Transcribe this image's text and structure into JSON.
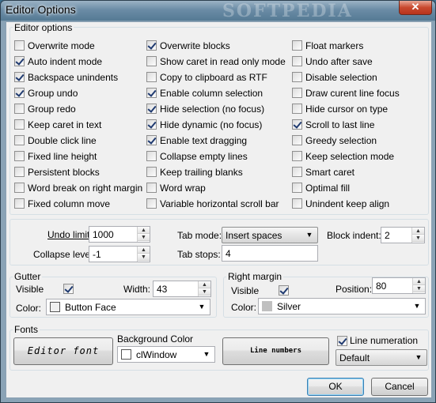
{
  "window": {
    "title": "Editor Options",
    "watermark": "SOFTPEDIA",
    "close_glyph": "✕"
  },
  "editor_options": {
    "label": "Editor options",
    "columns": [
      [
        {
          "label": "Overwrite mode",
          "checked": false
        },
        {
          "label": "Auto indent mode",
          "checked": true
        },
        {
          "label": "Backspace unindents",
          "checked": true
        },
        {
          "label": "Group undo",
          "checked": true
        },
        {
          "label": "Group redo",
          "checked": false
        },
        {
          "label": "Keep caret in text",
          "checked": false
        },
        {
          "label": "Double click line",
          "checked": false
        },
        {
          "label": "Fixed line height",
          "checked": false
        },
        {
          "label": "Persistent blocks",
          "checked": false
        },
        {
          "label": "Word break on right margin",
          "checked": false
        },
        {
          "label": "Fixed column move",
          "checked": false
        }
      ],
      [
        {
          "label": "Overwrite blocks",
          "checked": true
        },
        {
          "label": "Show caret in read only mode",
          "checked": false
        },
        {
          "label": "Copy to clipboard as RTF",
          "checked": false
        },
        {
          "label": "Enable column selection",
          "checked": true
        },
        {
          "label": "Hide selection (no focus)",
          "checked": true
        },
        {
          "label": "Hide dynamic (no focus)",
          "checked": true
        },
        {
          "label": "Enable text dragging",
          "checked": true
        },
        {
          "label": "Collapse empty lines",
          "checked": false
        },
        {
          "label": "Keep trailing blanks",
          "checked": false
        },
        {
          "label": "Word wrap",
          "checked": false
        },
        {
          "label": "Variable horizontal scroll bar",
          "checked": false
        }
      ],
      [
        {
          "label": "Float markers",
          "checked": false
        },
        {
          "label": "Undo after save",
          "checked": false
        },
        {
          "label": "Disable selection",
          "checked": false
        },
        {
          "label": "Draw curent line focus",
          "checked": false
        },
        {
          "label": "Hide cursor on type",
          "checked": false
        },
        {
          "label": "Scroll to last line",
          "checked": true
        },
        {
          "label": "Greedy selection",
          "checked": false
        },
        {
          "label": "Keep selection mode",
          "checked": false
        },
        {
          "label": "Smart caret",
          "checked": false
        },
        {
          "label": "Optimal fill",
          "checked": false
        },
        {
          "label": "Unindent keep align",
          "checked": false
        }
      ]
    ]
  },
  "limits": {
    "undo_limit_label": "Undo limit:",
    "undo_limit_value": "1000",
    "collapse_level_label": "Collapse level:",
    "collapse_level_value": "-1",
    "tab_mode_label": "Tab mode:",
    "tab_mode_value": "Insert spaces",
    "tab_stops_label": "Tab stops:",
    "tab_stops_value": "4",
    "block_indent_label": "Block indent:",
    "block_indent_value": "2"
  },
  "gutter": {
    "label": "Gutter",
    "visible_label": "Visible",
    "visible_checked": true,
    "width_label": "Width:",
    "width_value": "43",
    "color_label": "Color:",
    "color_value": "Button Face",
    "color_swatch": "#f0f0f0"
  },
  "right_margin": {
    "label": "Right margin",
    "visible_label": "Visible",
    "visible_checked": true,
    "position_label": "Position:",
    "position_value": "80",
    "color_label": "Color:",
    "color_value": "Silver",
    "color_swatch": "#c0c0c0"
  },
  "fonts": {
    "label": "Fonts",
    "editor_font_button": "Editor font",
    "background_color_label": "Background Color",
    "background_color_value": "clWindow",
    "background_color_swatch": "#ffffff",
    "line_numbers_button": "Line numbers",
    "line_numeration_label": "Line numeration",
    "line_numeration_checked": true,
    "line_numeration_value": "Default"
  },
  "buttons": {
    "ok": "OK",
    "cancel": "Cancel"
  }
}
